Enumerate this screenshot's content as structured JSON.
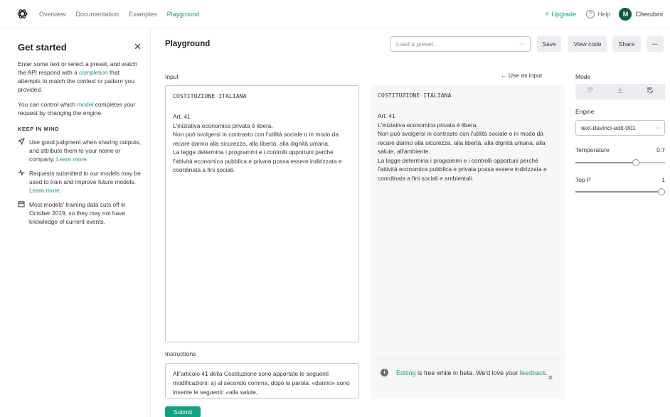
{
  "nav": {
    "links": [
      "Overview",
      "Documentation",
      "Examples",
      "Playground"
    ],
    "active": "Playground",
    "upgrade": "Upgrade",
    "help": "Help",
    "user_initial": "M",
    "user_name": "Cherubini"
  },
  "sidebar": {
    "title": "Get started",
    "intro_pre": "Enter some text or select a preset, and watch the API respond with a ",
    "intro_link": "completion",
    "intro_post": " that attempts to match the context or pattern you provided.",
    "control_pre": "You can control which ",
    "control_link": "model",
    "control_post": " completes your request by changing the engine.",
    "keep_in_mind": "KEEP IN MIND",
    "tips": [
      {
        "icon": "send-icon",
        "text": "Use good judgment when sharing outputs, and attribute them to your name or company.",
        "link": "Learn more."
      },
      {
        "icon": "activity-icon",
        "text": "Requests submitted to our models may be used to train and improve future models.",
        "link": "Learn more."
      },
      {
        "icon": "calendar-icon",
        "text": "Most models' training data cuts off in October 2019, so they may not have knowledge of current events.",
        "link": ""
      }
    ]
  },
  "main": {
    "title": "Playground",
    "preset_placeholder": "Load a preset...",
    "save": "Save",
    "view_code": "View code",
    "share": "Share",
    "more": "···",
    "input_label": "Input",
    "use_as_input": "← Use as input",
    "input": {
      "title": "COSTITUZIONE ITALIANA",
      "lines": [
        "Art. 41",
        "L'iniziativa economica privata è libera.",
        "Non può svolgersi in contrasto con l'utilità sociale o in modo da recare danno alla sicurezza, alla libertà, alla dignità umana.",
        "La legge determina i programmi e i controlli opportuni perché l'attività economica pubblica e privata possa essere indirizzata e coordinata a fini sociali."
      ]
    },
    "output": {
      "title": "COSTITUZIONE ITALIANA",
      "lines": [
        "Art. 41",
        "L'iniziativa economica privata è libera.",
        "Non può svolgersi in contrasto con l'utilità sociale o in modo da recare danno alla sicurezza, alla libertà, alla dignità umana, alla salute, all'ambiente.",
        "La legge determina i programmi e i controlli opportuni perché l'attività economica pubblica e privata possa essere indirizzata e coordinata a fini sociali e ambientali."
      ]
    },
    "instructions_label": "Instructions",
    "instructions": "All'articolo 41 della Costituzione sono apportate le seguenti modificazioni: a) al secondo comma, dopo la parola: «danno» sono inserite le seguenti: «alla salute,",
    "submit": "Submit",
    "beta": {
      "link1": "Editing",
      "text": " is free while in beta. We'd love your ",
      "link2": "feedback",
      "end": "."
    }
  },
  "settings": {
    "mode_label": "Mode",
    "modes": [
      "complete-icon",
      "insert-icon",
      "edit-icon"
    ],
    "mode_selected": "edit-icon",
    "engine_label": "Engine",
    "engine": "text-davinci-edit-001",
    "temperature_label": "Temperature",
    "temperature": "0.7",
    "temperature_fraction": 0.7,
    "top_p_label": "Top P",
    "top_p": "1",
    "top_p_fraction": 1.0
  },
  "colors": {
    "accent": "#10a37f",
    "avatar": "#0d5e3a",
    "panel_bg": "#f7f7f8"
  }
}
